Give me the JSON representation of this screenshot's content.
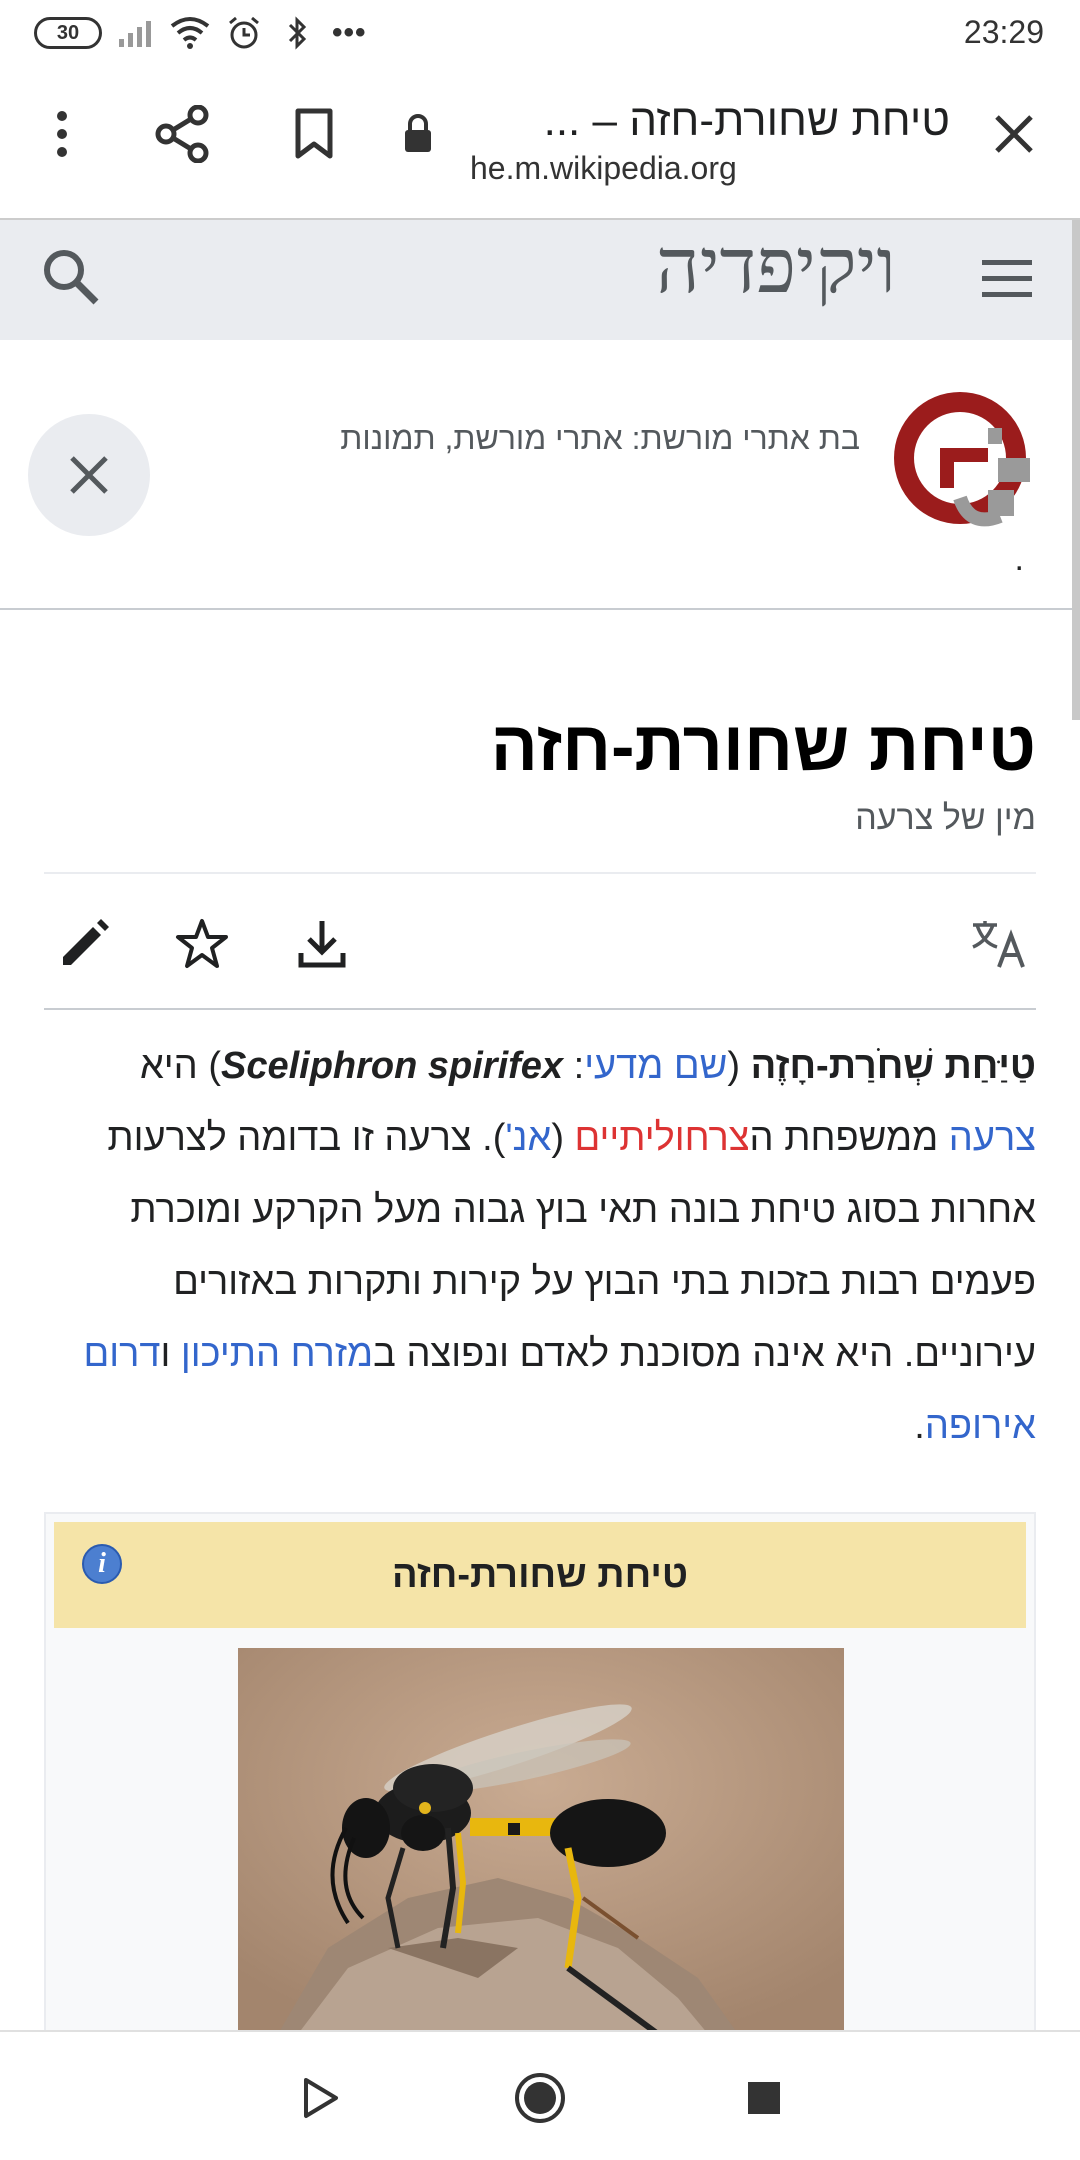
{
  "status_bar": {
    "battery": "30",
    "dots": "•••",
    "time": "23:29"
  },
  "browser": {
    "page_title": "טיחת שחורת-חזה – ...",
    "domain": "he.m.wikipedia.org"
  },
  "wiki": {
    "logo_text": "ויקיפדיה"
  },
  "banner": {
    "text": "בת אתרי מורשת: אתרי מורשת, תמונות",
    "dot": "."
  },
  "article": {
    "title": "טיחת שחורת-חזה",
    "subtitle": "מין של צרעה",
    "lead": {
      "term": "טַיַּחַת שְׁחֹרַת-חָזֶה",
      "paren_open": " (",
      "sci_label": "שם מדעי",
      "colon": ": ",
      "sci_name": "Sceliphron spirifex",
      "paren_close": ")",
      "line2_a": " היא ",
      "link_wasp": "צרעה",
      "line2_b": " ממשפחת ה",
      "link_family": "צרחוליתיים",
      "line2_c": " (",
      "link_en": "אנ'",
      "line2_d": "). צרעה זו בדומה לצרעות אחרות בסוג טיחת בונה תאי בוץ גבוה מעל הקרקע ומוכרת פעמים רבות בזכות בתי הבוץ על קירות ותקרות באזורים עירוניים. היא אינה מסוכנת לאדם ונפוצה ב",
      "link_me": "מזרח התיכון",
      "line2_e": " ו",
      "link_eu": "דרום אירופה",
      "end": "."
    }
  },
  "infobox": {
    "title": "טיחת שחורת-חזה",
    "info_icon": "i"
  },
  "colors": {
    "link": "#3366cc",
    "redlink": "#d33",
    "infobox_header": "#f5e4a8",
    "wiki_header_bg": "#eaecf0"
  }
}
